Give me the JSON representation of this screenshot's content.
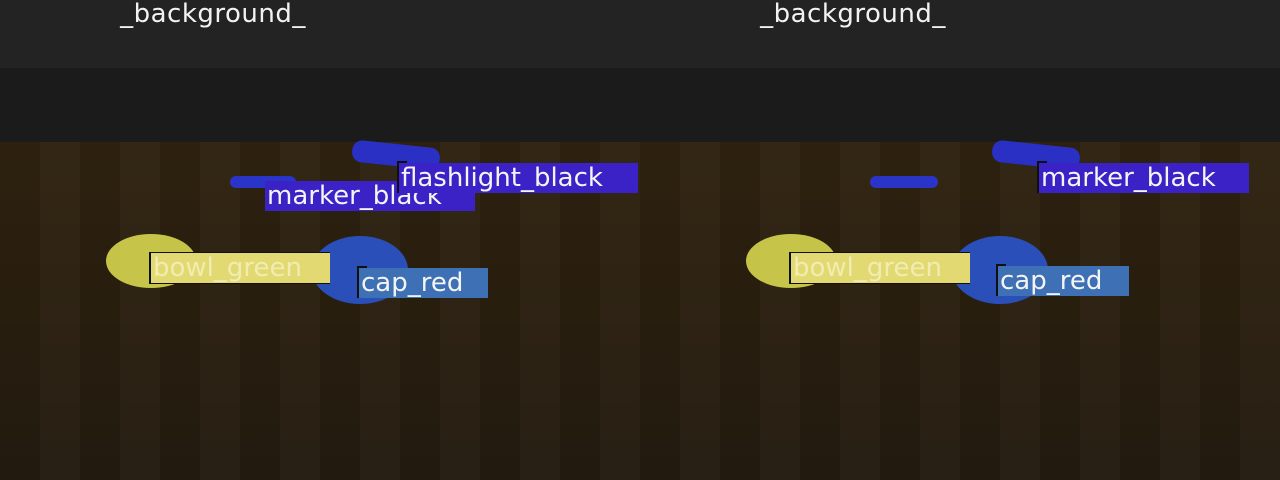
{
  "panels": [
    {
      "title": "_background_",
      "labels": {
        "flashlight": "flashlight_black",
        "marker": "marker_black",
        "bowl": "bowl_green",
        "cap": "cap_red"
      }
    },
    {
      "title": "_background_",
      "labels": {
        "marker": "marker_black",
        "bowl": "bowl_green",
        "cap": "cap_red"
      }
    }
  ],
  "colors": {
    "header": "#232323",
    "table": "#2d2110",
    "label_blue": "#3a21c8",
    "label_yellow": "#e2d871",
    "label_cap": "#3d6fb6",
    "mask_yellow": "#c9c84a",
    "mask_blue": "#2a45c0",
    "mask_dark_blue": "#2a2fc0"
  }
}
